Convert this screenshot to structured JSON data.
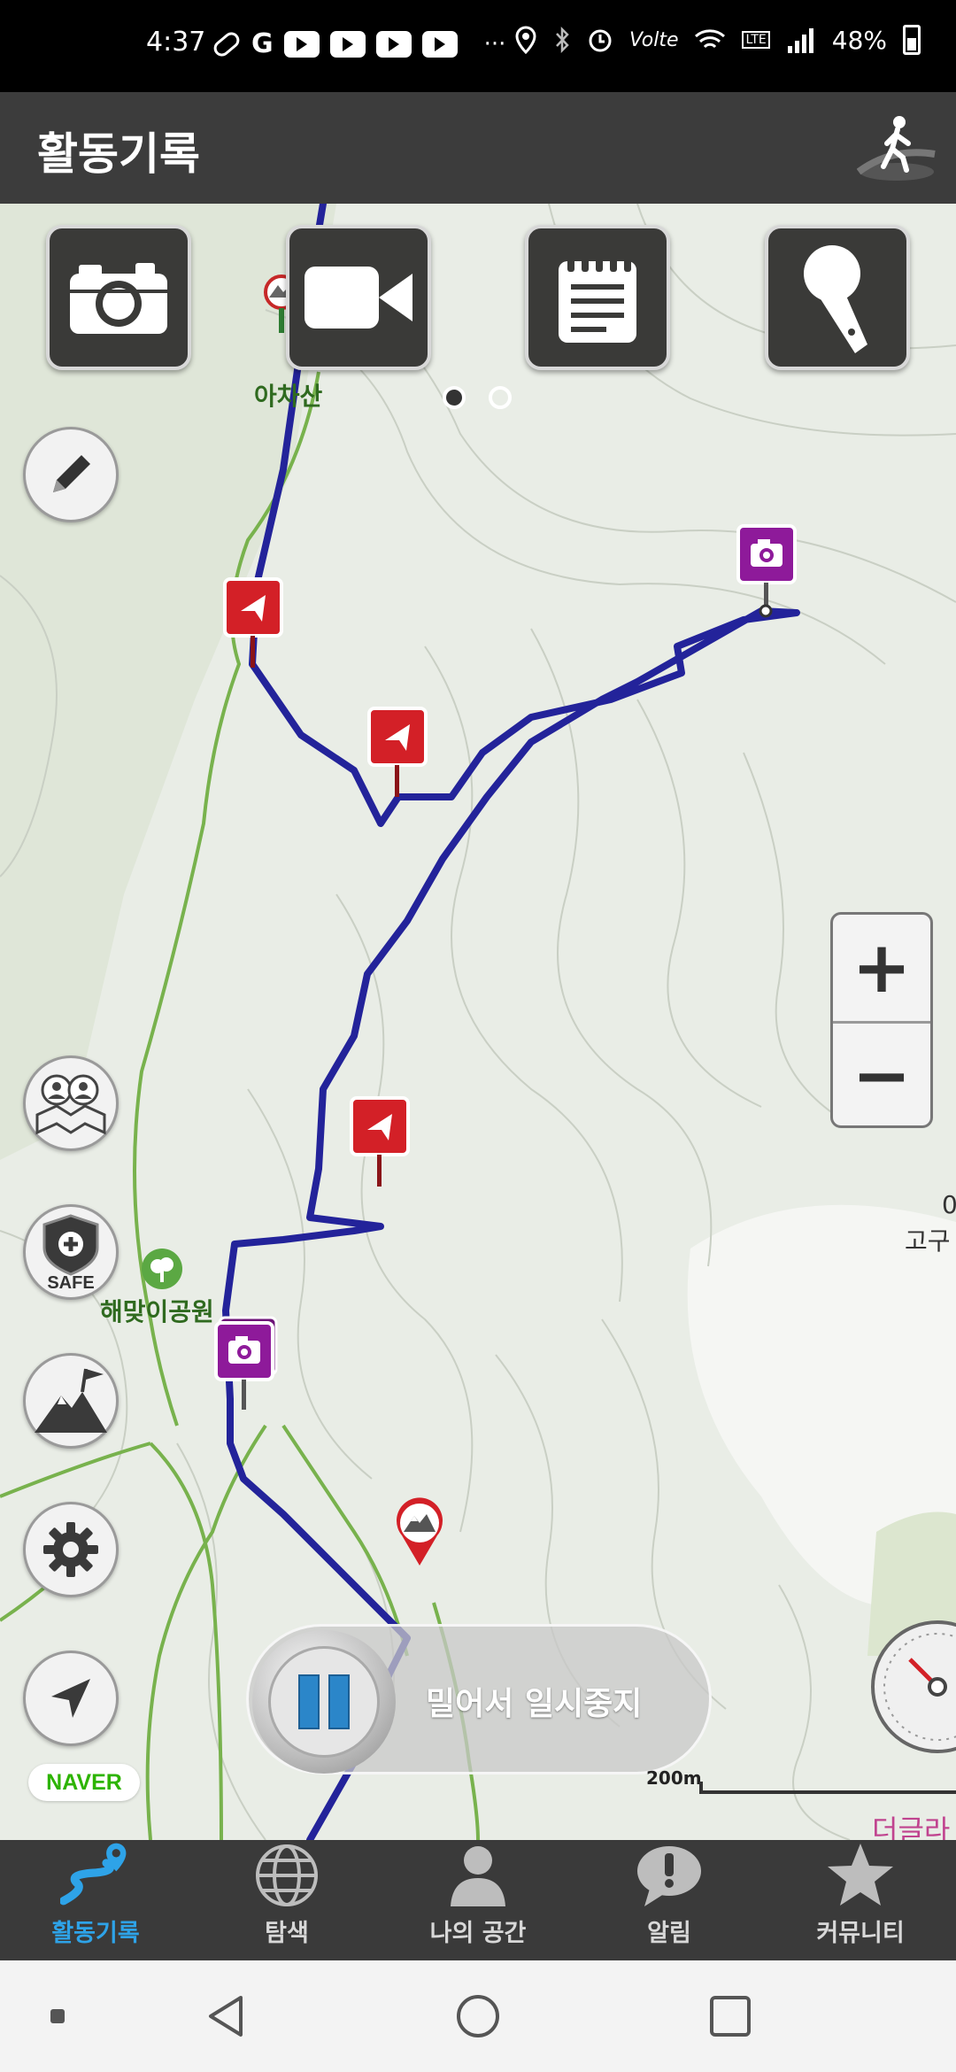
{
  "status_bar": {
    "time": "4:37",
    "network": "Volte",
    "lte": "LTE",
    "battery": "48%"
  },
  "header": {
    "title": "활동기록"
  },
  "quick_actions": [
    {
      "name": "camera-button",
      "icon": "camera-icon"
    },
    {
      "name": "video-button",
      "icon": "video-camera-icon"
    },
    {
      "name": "memo-button",
      "icon": "notepad-icon"
    },
    {
      "name": "voice-button",
      "icon": "microphone-icon"
    }
  ],
  "pager": {
    "current": 1,
    "total": 2
  },
  "map": {
    "labels": {
      "peak": "아차산",
      "park": "해맞이공원",
      "right_edge": "고구",
      "right_edge_num": "0",
      "corner": "더글라스"
    },
    "scale": "200m",
    "provider": "NAVER",
    "safe_label": "SAFE",
    "route_color": "#23239a",
    "trail_color": "#74b04a"
  },
  "controls": {
    "zoom_in": "+",
    "zoom_out": "−",
    "pause_slider": "밀어서 일시중지"
  },
  "bottom_nav": [
    {
      "label": "활동기록",
      "icon": "activity-route-icon",
      "active": true
    },
    {
      "label": "탐색",
      "icon": "globe-icon",
      "active": false
    },
    {
      "label": "나의 공간",
      "icon": "person-icon",
      "active": false
    },
    {
      "label": "알림",
      "icon": "alert-bubble-icon",
      "active": false
    },
    {
      "label": "커뮤니티",
      "icon": "star-icon",
      "active": false
    }
  ],
  "colors": {
    "accent": "#2ea3e8",
    "marker_red": "#d32027",
    "marker_purple": "#8e1a9a"
  }
}
